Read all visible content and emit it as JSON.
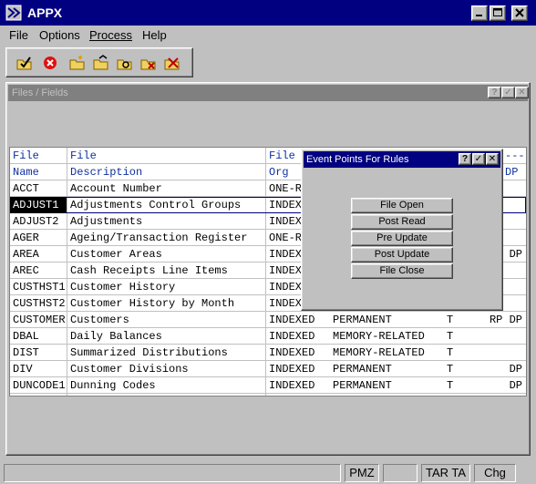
{
  "window": {
    "title": "APPX"
  },
  "menu": [
    "File",
    "Options",
    "Process",
    "Help"
  ],
  "toolbar": [
    "check-folder-icon",
    "cancel-icon",
    "new-folder-icon",
    "open-folder-icon",
    "folder-view-icon",
    "folder-remove-icon",
    "folder-delete-icon"
  ],
  "files_window": {
    "title": "Files / Fields"
  },
  "table": {
    "headers": {
      "file": [
        "File",
        "Name"
      ],
      "description": [
        "File",
        "Description"
      ],
      "org": [
        "File",
        "Org"
      ],
      "trailing": [
        "---",
        "DP"
      ]
    },
    "rows": [
      {
        "name": "ACCT",
        "description": "Account Number",
        "org": "ONE-R",
        "type": "",
        "t": "",
        "flags": ""
      },
      {
        "name": "ADJUST1",
        "description": "Adjustments Control Groups",
        "org": "INDEX",
        "type": "",
        "t": "",
        "flags": ""
      },
      {
        "name": "ADJUST2",
        "description": "Adjustments",
        "org": "INDEX",
        "type": "",
        "t": "",
        "flags": ""
      },
      {
        "name": "AGER",
        "description": "Ageing/Transaction Register",
        "org": "ONE-R",
        "type": "",
        "t": "",
        "flags": ""
      },
      {
        "name": "AREA",
        "description": "Customer Areas",
        "org": "INDEX",
        "type": "",
        "t": "",
        "flags": "DP"
      },
      {
        "name": "AREC",
        "description": "Cash Receipts Line Items",
        "org": "INDEX",
        "type": "",
        "t": "",
        "flags": ""
      },
      {
        "name": "CUSTHST1",
        "description": "Customer History",
        "org": "INDEX",
        "type": "",
        "t": "",
        "flags": ""
      },
      {
        "name": "CUSTHST2",
        "description": "Customer History by Month",
        "org": "INDEX",
        "type": "",
        "t": "",
        "flags": ""
      },
      {
        "name": "CUSTOMER",
        "description": "Customers",
        "org": "INDEXED",
        "type": "PERMANENT",
        "t": "T",
        "flags": "RP DP"
      },
      {
        "name": "DBAL",
        "description": "Daily Balances",
        "org": "INDEXED",
        "type": "MEMORY-RELATED",
        "t": "T",
        "flags": ""
      },
      {
        "name": "DIST",
        "description": "Summarized Distributions",
        "org": "INDEXED",
        "type": "MEMORY-RELATED",
        "t": "T",
        "flags": ""
      },
      {
        "name": "DIV",
        "description": "Customer Divisions",
        "org": "INDEXED",
        "type": "PERMANENT",
        "t": "T",
        "flags": "DP"
      },
      {
        "name": "DUNCODE1",
        "description": "Dunning Codes",
        "org": "INDEXED",
        "type": "PERMANENT",
        "t": "T",
        "flags": "DP"
      }
    ]
  },
  "event_dialog": {
    "title": "Event Points For Rules",
    "buttons": [
      "File Open",
      "Post Read",
      "Pre Update",
      "Post Update",
      "File Close"
    ]
  },
  "status": [
    "PMZ",
    "TAR TA",
    "Chg"
  ]
}
